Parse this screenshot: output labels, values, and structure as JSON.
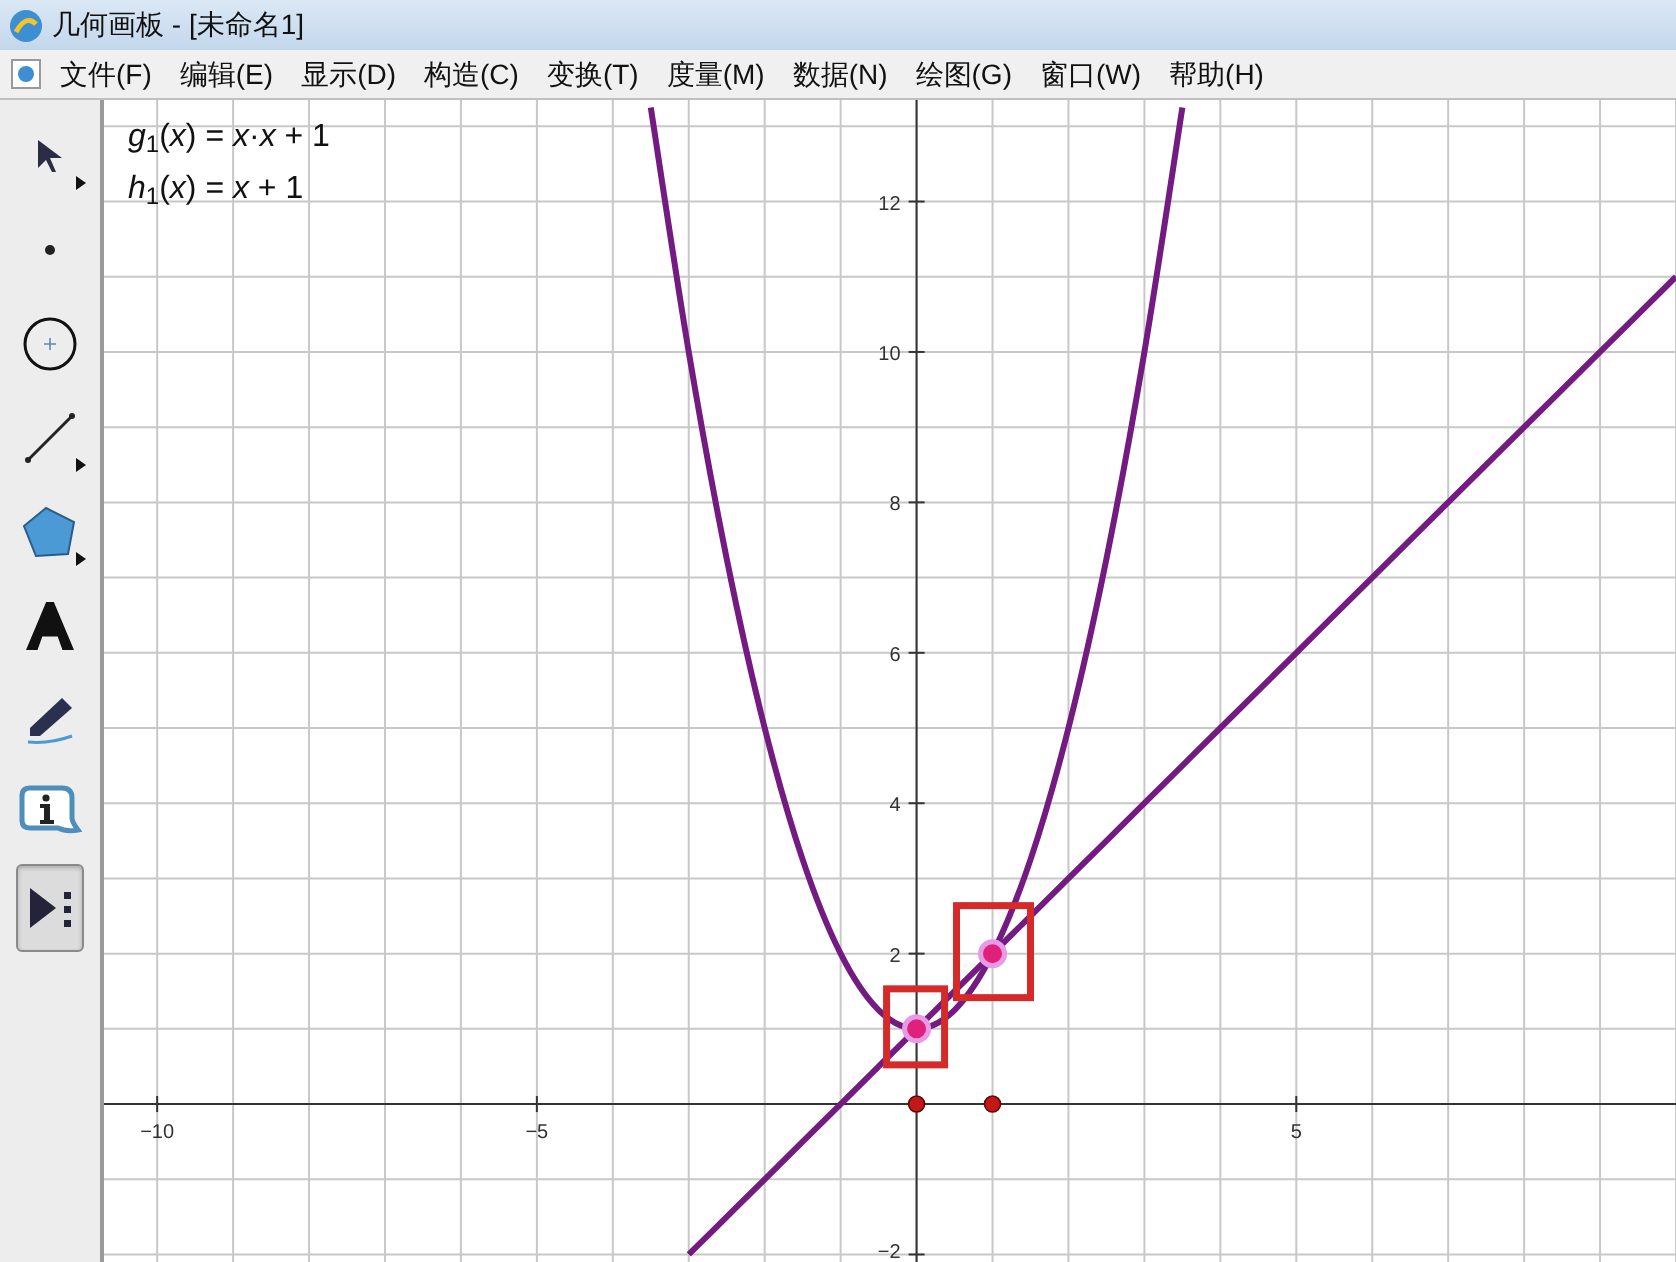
{
  "window": {
    "title": "几何画板 - [未命名1]"
  },
  "menu": [
    "文件(F)",
    "编辑(E)",
    "显示(D)",
    "构造(C)",
    "变换(T)",
    "度量(M)",
    "数据(N)",
    "绘图(G)",
    "窗口(W)",
    "帮助(H)"
  ],
  "toolbar": [
    {
      "kind": "arrow",
      "selected": false,
      "submenu": true
    },
    {
      "kind": "point",
      "selected": false,
      "submenu": false
    },
    {
      "kind": "compass",
      "selected": false,
      "submenu": false
    },
    {
      "kind": "segment",
      "selected": false,
      "submenu": true
    },
    {
      "kind": "polygon",
      "selected": false,
      "submenu": true
    },
    {
      "kind": "text",
      "selected": false,
      "submenu": false
    },
    {
      "kind": "marker",
      "selected": false,
      "submenu": false
    },
    {
      "kind": "info",
      "selected": false,
      "submenu": false
    },
    {
      "kind": "custom",
      "selected": true,
      "submenu": false
    }
  ],
  "graph": {
    "intersections": [
      {
        "highlighted": true
      },
      {
        "highlighted": true
      }
    ],
    "chart_data": {
      "type": "line",
      "grid": true,
      "xlim": [
        -10.7,
        10
      ],
      "ylim": [
        -2.1,
        13.35
      ],
      "xticks": [
        {
          "value": -10,
          "label": "−10"
        },
        {
          "value": -5,
          "label": "−5"
        },
        {
          "value": 5,
          "label": "5"
        }
      ],
      "yticks": [
        {
          "value": -2,
          "label": "−2"
        },
        {
          "value": 2,
          "label": "2"
        },
        {
          "value": 4,
          "label": "4"
        },
        {
          "value": 6,
          "label": "6"
        },
        {
          "value": 8,
          "label": "8"
        },
        {
          "value": 10,
          "label": "10"
        },
        {
          "value": 12,
          "label": "12"
        }
      ],
      "x": [
        -3.5,
        -3,
        -2.5,
        -2,
        -1.5,
        -1,
        -0.5,
        0,
        0.5,
        1,
        1.5,
        2,
        2.5,
        3,
        3.5,
        4,
        5,
        6,
        7,
        8,
        9,
        10
      ],
      "series": [
        {
          "name": "*g*$_{1}$(*x*) = *x*·*x* + 1",
          "color": "#741b82",
          "values": [
            13.25,
            10,
            7.25,
            5,
            3.25,
            2,
            1.25,
            1,
            1.25,
            2,
            3.25,
            5,
            7.25,
            10,
            13.25,
            null,
            null,
            null,
            null,
            null,
            null,
            null
          ]
        },
        {
          "name": "*h*$_{1}$(*x*) = *x* + 1",
          "color": "#741b82",
          "values": [
            null,
            -2,
            -1.5,
            -1,
            -0.5,
            0,
            0.5,
            1,
            1.5,
            2,
            2.5,
            3,
            3.5,
            4,
            4.5,
            5,
            6,
            7,
            8,
            9,
            10,
            11
          ]
        }
      ]
    }
  }
}
